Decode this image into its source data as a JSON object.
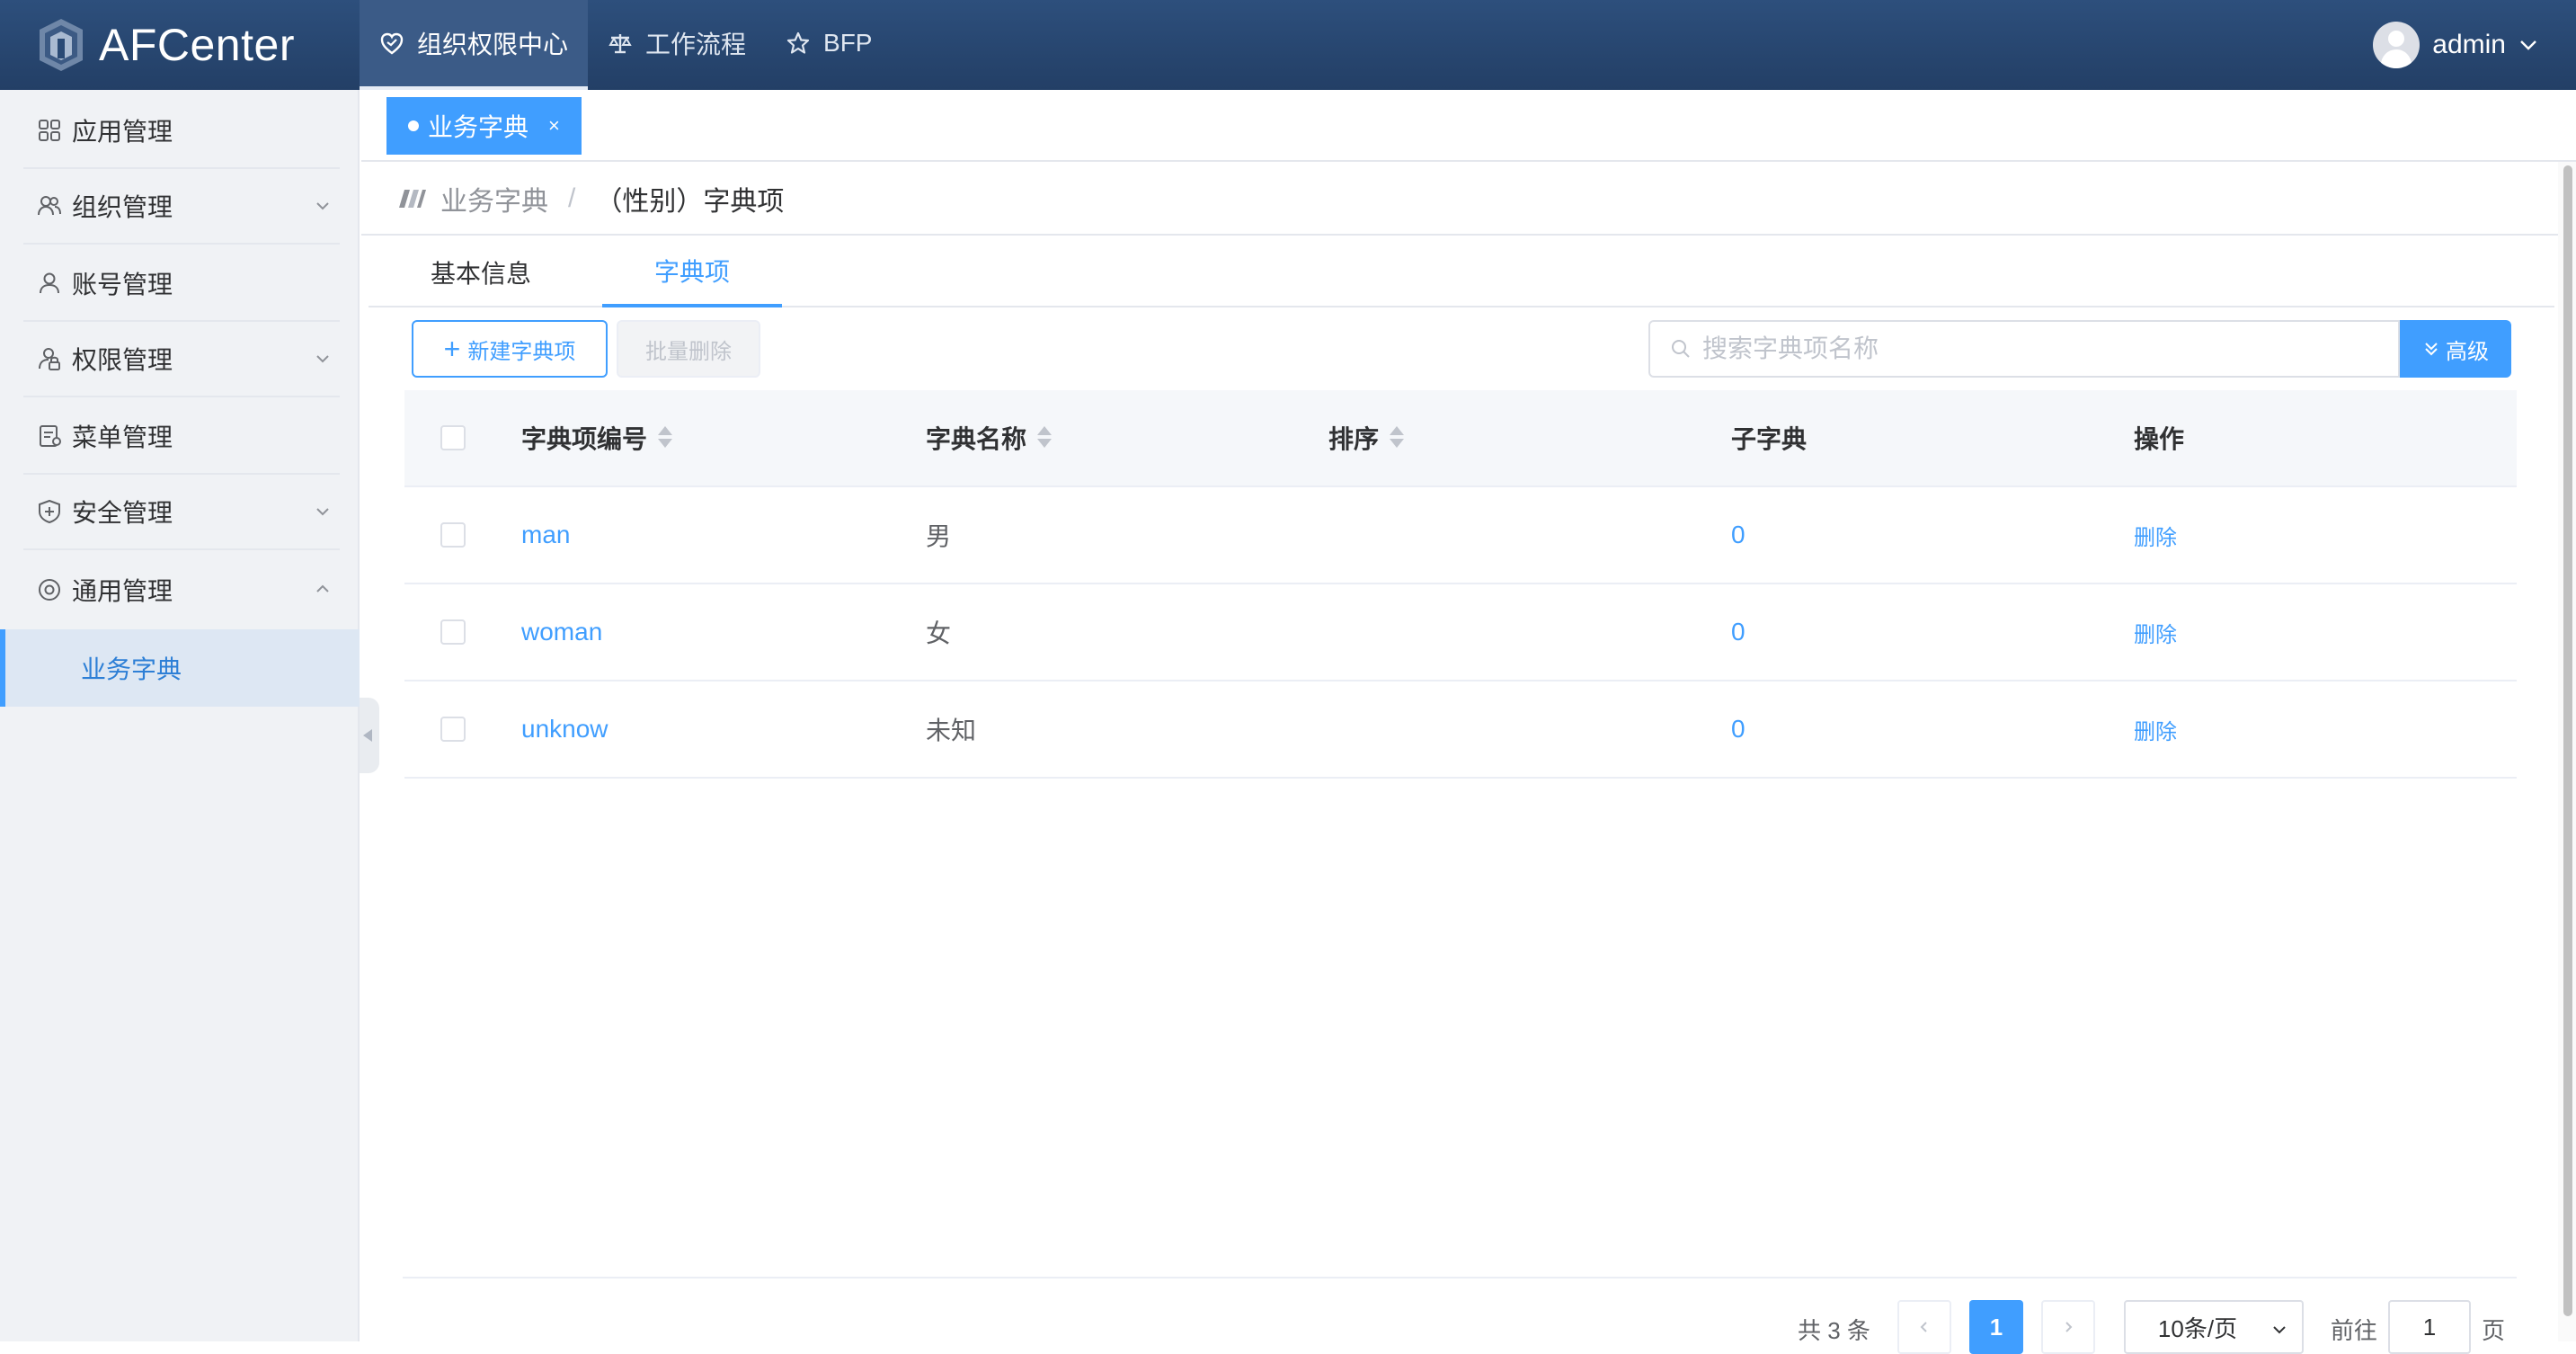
{
  "app": {
    "logo_text": "AFCenter"
  },
  "topnav": [
    {
      "label": "组织权限中心",
      "icon": "heart-shield-icon",
      "active": true
    },
    {
      "label": "工作流程",
      "icon": "scale-icon",
      "active": false
    },
    {
      "label": "BFP",
      "icon": "star-icon",
      "active": false
    }
  ],
  "user": {
    "name": "admin"
  },
  "sidebar": {
    "items": [
      {
        "label": "应用管理",
        "icon": "grid-icon"
      },
      {
        "label": "组织管理",
        "icon": "users-icon",
        "expandable": true
      },
      {
        "label": "账号管理",
        "icon": "user-icon"
      },
      {
        "label": "权限管理",
        "icon": "user-lock-icon",
        "expandable": true
      },
      {
        "label": "菜单管理",
        "icon": "menu-doc-icon"
      },
      {
        "label": "安全管理",
        "icon": "shield-plus-icon",
        "expandable": true
      },
      {
        "label": "通用管理",
        "icon": "settings-circle-icon",
        "expanded": true
      }
    ],
    "sub_item": "业务字典"
  },
  "tagbar": {
    "tag_label": "业务字典",
    "close": "×"
  },
  "breadcrumb": {
    "root": "业务字典",
    "sep": "/",
    "current": "（性别）字典项"
  },
  "tabs": {
    "basic": "基本信息",
    "items": "字典项"
  },
  "toolbar": {
    "new_label": "新建字典项",
    "batch_delete_label": "批量删除",
    "search_placeholder": "搜索字典项名称",
    "advanced_label": "高级"
  },
  "table": {
    "headers": {
      "code": "字典项编号",
      "name": "字典名称",
      "sort": "排序",
      "children": "子字典",
      "actions": "操作"
    },
    "rows": [
      {
        "code": "man",
        "name": "男",
        "sort": "",
        "children": "0",
        "action": "删除"
      },
      {
        "code": "woman",
        "name": "女",
        "sort": "",
        "children": "0",
        "action": "删除"
      },
      {
        "code": "unknow",
        "name": "未知",
        "sort": "",
        "children": "0",
        "action": "删除"
      }
    ]
  },
  "pagination": {
    "total": "共 3 条",
    "current_page": "1",
    "page_size": "10条/页",
    "goto_label": "前往",
    "goto_value": "1",
    "page_unit": "页"
  },
  "colors": {
    "primary": "#409eff",
    "topbar": "#2a4a75",
    "sidebar": "#f0f2f5"
  }
}
